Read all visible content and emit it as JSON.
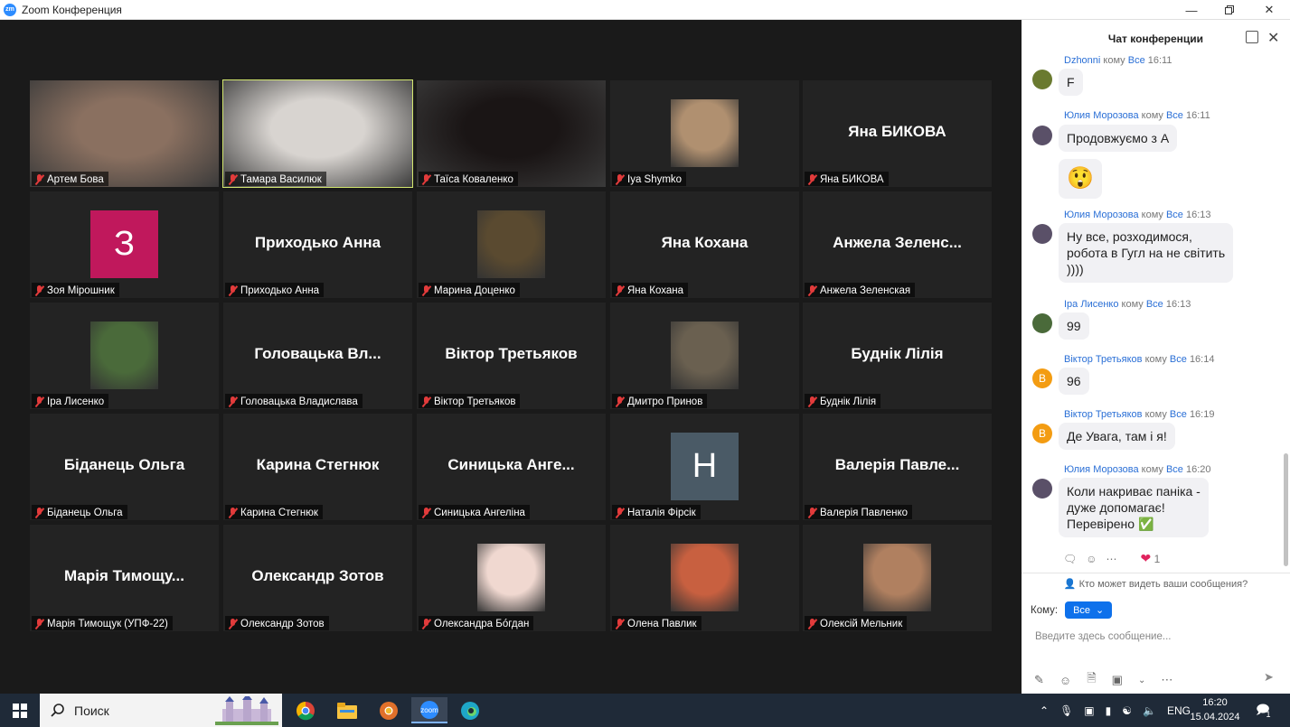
{
  "window": {
    "title": "Zoom Конференция",
    "app_icon": "zm",
    "controls": [
      "minimize-icon",
      "maximize-icon",
      "close-icon"
    ]
  },
  "participants": [
    {
      "name": "Артем Бова",
      "display": "video",
      "color": "#8a7060"
    },
    {
      "name": "Тамара Василюк",
      "display": "video",
      "active_speaker": true,
      "color": "#d8d4d0"
    },
    {
      "name": "Таїса Коваленко",
      "display": "video",
      "color": "#1a1515"
    },
    {
      "name": "Iya Shymko",
      "display": "photo",
      "color": "#b09070"
    },
    {
      "name": "Яна БИКОВА",
      "display": "name",
      "big_name": "Яна БИКОВА"
    },
    {
      "name": "Зоя Мірошник",
      "display": "letter",
      "letter": "З",
      "color": "#c0185c"
    },
    {
      "name": "Приходько Анна",
      "display": "name",
      "big_name": "Приходько Анна"
    },
    {
      "name": "Марина Доценко",
      "display": "photo",
      "color": "#5a4a30"
    },
    {
      "name": "Яна Кохана",
      "display": "name",
      "big_name": "Яна Кохана"
    },
    {
      "name": "Анжела Зеленская",
      "display": "name",
      "big_name": "Анжела  Зеленс..."
    },
    {
      "name": "Іра Лисенко",
      "display": "photo",
      "color": "#4a6a3a"
    },
    {
      "name": "Головацька Владислава",
      "display": "name",
      "big_name": "Головацька  Вл..."
    },
    {
      "name": "Віктор Третьяков",
      "display": "name",
      "big_name": "Віктор Третьяков"
    },
    {
      "name": "Дмитро Принов",
      "display": "photo",
      "color": "#6a6050"
    },
    {
      "name": "Буднік Лілія",
      "display": "name",
      "big_name": "Буднік Лілія"
    },
    {
      "name": "Біданець Ольга",
      "display": "name",
      "big_name": "Біданець Ольга"
    },
    {
      "name": "Карина Стегнюк",
      "display": "name",
      "big_name": "Карина Стегнюк"
    },
    {
      "name": "Синицька Ангеліна",
      "display": "name",
      "big_name": "Синицька  Анге..."
    },
    {
      "name": "Наталія Фірсік",
      "display": "letter",
      "letter": "H",
      "color": "#4a5a66"
    },
    {
      "name": "Валерія Павленко",
      "display": "name",
      "big_name": "Валерія  Павле..."
    },
    {
      "name": "Марія Тимощук (УПФ-22)",
      "display": "name",
      "big_name": "Марія  Тимощу..."
    },
    {
      "name": "Олександр Зотов",
      "display": "name",
      "big_name": "Олександр Зотов"
    },
    {
      "name": "Олександра Бóгдан",
      "display": "photo",
      "color": "#f0d8d0"
    },
    {
      "name": "Олена Павлик",
      "display": "photo",
      "color": "#c86040"
    },
    {
      "name": "Олексій Мельник",
      "display": "photo",
      "color": "#b08060"
    }
  ],
  "chat": {
    "title": "Чат конференции",
    "to_keyword": "кому",
    "messages": [
      {
        "sender": "Dzhonni",
        "to": "Все",
        "time": "16:11",
        "avatar_color": "#6a7a30",
        "lines": [
          "F"
        ]
      },
      {
        "sender": "Юлия Морозова",
        "to": "Все",
        "time": "16:11",
        "avatar_color": "#5a5068",
        "lines": [
          "Продовжуємо з А"
        ],
        "extra": "😲"
      },
      {
        "sender": "Юлия Морозова",
        "to": "Все",
        "time": "16:13",
        "avatar_color": "#5a5068",
        "lines": [
          "Ну все, розходимося,",
          "робота в Гугл на не світить",
          "))))"
        ]
      },
      {
        "sender": "Іра Лисенко",
        "to": "Все",
        "time": "16:13",
        "avatar_color": "#4a6a3a",
        "lines": [
          "99"
        ]
      },
      {
        "sender": "Віктор Третьяков",
        "to": "Все",
        "time": "16:14",
        "avatar_letter": "В",
        "lines": [
          "96"
        ]
      },
      {
        "sender": "Віктор Третьяков",
        "to": "Все",
        "time": "16:19",
        "avatar_letter": "В",
        "lines": [
          "Де Увага, там і я!"
        ]
      },
      {
        "sender": "Юлия Морозова",
        "to": "Все",
        "time": "16:20",
        "avatar_color": "#5a5068",
        "lines": [
          "Коли накриває паніка -",
          "дуже допомагає!",
          "Перевірено ✅"
        ]
      }
    ],
    "reaction_count": "1",
    "privacy_text": "Кто может видеть ваши сообщения?",
    "to_label": "Кому:",
    "to_value": "Все",
    "input_placeholder": "Введите здесь сообщение..."
  },
  "taskbar": {
    "search_text": "Поиск",
    "language": "ENG",
    "time": "16:20",
    "date": "15.04.2024",
    "notification_count": "1",
    "apps": [
      "chrome-icon",
      "file-explorer-icon",
      "chrome-canary-icon",
      "zoom-icon",
      "edge-icon"
    ]
  }
}
